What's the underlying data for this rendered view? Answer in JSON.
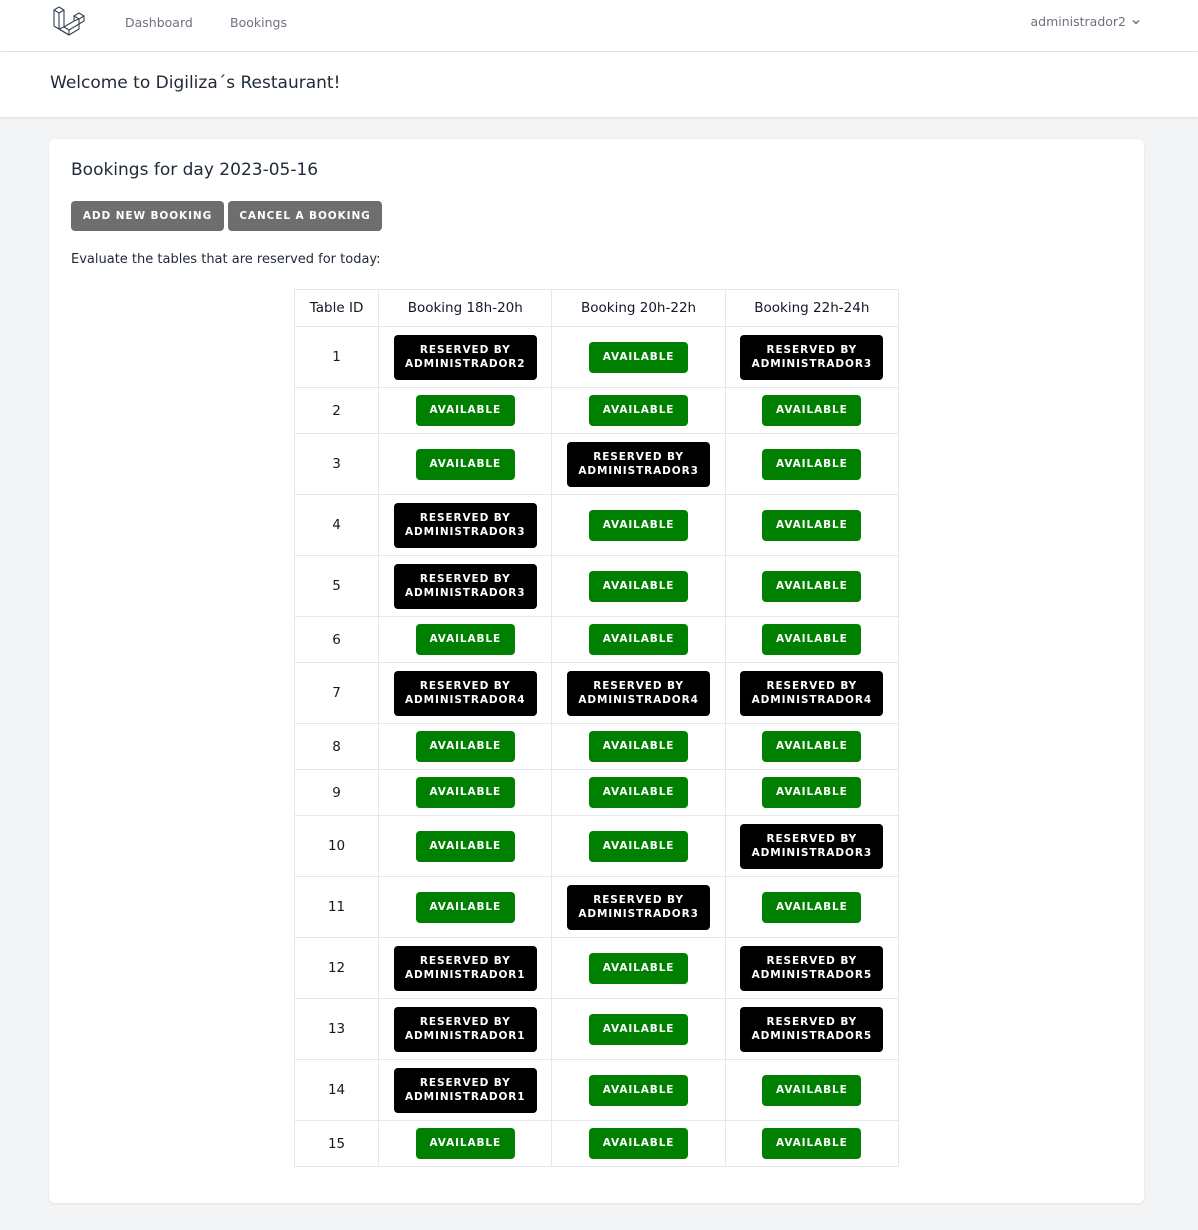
{
  "nav": {
    "links": [
      "Dashboard",
      "Bookings"
    ],
    "user": "administrador2"
  },
  "header": {
    "title": "Welcome to Digiliza´s Restaurant!"
  },
  "bookings": {
    "title": "Bookings for day 2023-05-16",
    "add_button": "ADD NEW BOOKING",
    "cancel_button": "CANCEL A BOOKING",
    "intro": "Evaluate the tables that are reserved for today:",
    "columns": [
      "Table ID",
      "Booking 18h-20h",
      "Booking 20h-22h",
      "Booking 22h-24h"
    ],
    "rows": [
      {
        "id": "1",
        "slots": [
          "RESERVED BY ADMINISTRADOR2",
          "AVAILABLE",
          "RESERVED BY ADMINISTRADOR3"
        ]
      },
      {
        "id": "2",
        "slots": [
          "AVAILABLE",
          "AVAILABLE",
          "AVAILABLE"
        ]
      },
      {
        "id": "3",
        "slots": [
          "AVAILABLE",
          "RESERVED BY ADMINISTRADOR3",
          "AVAILABLE"
        ]
      },
      {
        "id": "4",
        "slots": [
          "RESERVED BY ADMINISTRADOR3",
          "AVAILABLE",
          "AVAILABLE"
        ]
      },
      {
        "id": "5",
        "slots": [
          "RESERVED BY ADMINISTRADOR3",
          "AVAILABLE",
          "AVAILABLE"
        ]
      },
      {
        "id": "6",
        "slots": [
          "AVAILABLE",
          "AVAILABLE",
          "AVAILABLE"
        ]
      },
      {
        "id": "7",
        "slots": [
          "RESERVED BY ADMINISTRADOR4",
          "RESERVED BY ADMINISTRADOR4",
          "RESERVED BY ADMINISTRADOR4"
        ]
      },
      {
        "id": "8",
        "slots": [
          "AVAILABLE",
          "AVAILABLE",
          "AVAILABLE"
        ]
      },
      {
        "id": "9",
        "slots": [
          "AVAILABLE",
          "AVAILABLE",
          "AVAILABLE"
        ]
      },
      {
        "id": "10",
        "slots": [
          "AVAILABLE",
          "AVAILABLE",
          "RESERVED BY ADMINISTRADOR3"
        ]
      },
      {
        "id": "11",
        "slots": [
          "AVAILABLE",
          "RESERVED BY ADMINISTRADOR3",
          "AVAILABLE"
        ]
      },
      {
        "id": "12",
        "slots": [
          "RESERVED BY ADMINISTRADOR1",
          "AVAILABLE",
          "RESERVED BY ADMINISTRADOR5"
        ]
      },
      {
        "id": "13",
        "slots": [
          "RESERVED BY ADMINISTRADOR1",
          "AVAILABLE",
          "RESERVED BY ADMINISTRADOR5"
        ]
      },
      {
        "id": "14",
        "slots": [
          "RESERVED BY ADMINISTRADOR1",
          "AVAILABLE",
          "AVAILABLE"
        ]
      },
      {
        "id": "15",
        "slots": [
          "AVAILABLE",
          "AVAILABLE",
          "AVAILABLE"
        ]
      }
    ]
  },
  "colors": {
    "available": "#008000",
    "reserved": "#000000",
    "action_button": "#6e6e6e"
  },
  "icons": {
    "logo": "laravel-logo-icon",
    "user_menu": "chevron-down-icon"
  }
}
